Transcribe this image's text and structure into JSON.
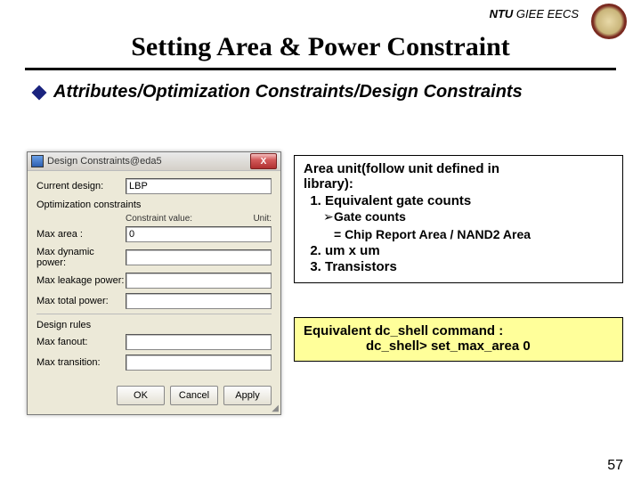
{
  "header": {
    "ntu": "NTU",
    "dept": "GIEE EECS"
  },
  "title": "Setting Area & Power Constraint",
  "menu_path": "Attributes/Optimization Constraints/Design Constraints",
  "dialog": {
    "title": "Design Constraints@eda5",
    "current_design_label": "Current design:",
    "current_design_value": "LBP",
    "group_opt": "Optimization constraints",
    "col_value": "Constraint value:",
    "col_unit": "Unit:",
    "rows_opt": {
      "max_area": "Max area :",
      "max_area_value": "0",
      "max_dyn": "Max dynamic power:",
      "max_leak": "Max leakage power:",
      "max_total": "Max total power:"
    },
    "group_rules": "Design rules",
    "rows_rules": {
      "max_fanout": "Max fanout:",
      "max_transition": "Max transition:"
    },
    "buttons": {
      "ok": "OK",
      "cancel": "Cancel",
      "apply": "Apply"
    }
  },
  "info1": {
    "heading_a": "Area unit(follow unit defined in",
    "heading_b": "library):",
    "item1": "Equivalent gate counts",
    "sub1": "Gate counts",
    "sub1_eq": "= Chip Report Area / NAND2 Area",
    "item2": "um x um",
    "item3": "Transistors"
  },
  "info2": {
    "line1": "Equivalent dc_shell command :",
    "line2": "dc_shell> set_max_area 0"
  },
  "page": "57"
}
